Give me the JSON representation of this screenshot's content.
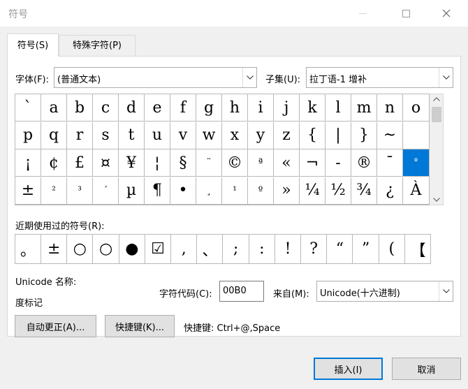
{
  "window": {
    "title": "符号"
  },
  "tabs": [
    {
      "label": "符号(S)"
    },
    {
      "label": "特殊字符(P)"
    }
  ],
  "font_label": "字体(F):",
  "font_value": "(普通文本)",
  "subset_label": "子集(U):",
  "subset_value": "拉丁语-1 增补",
  "symbols": [
    "`",
    "a",
    "b",
    "c",
    "d",
    "e",
    "f",
    "g",
    "h",
    "i",
    "j",
    "k",
    "l",
    "m",
    "n",
    "o",
    "p",
    "q",
    "r",
    "s",
    "t",
    "u",
    "v",
    "w",
    "x",
    "y",
    "z",
    "{",
    "|",
    "}",
    "~",
    "",
    "¡",
    "¢",
    "£",
    "¤",
    "¥",
    "¦",
    "§",
    "¨",
    "©",
    "ª",
    "«",
    "¬",
    "-",
    "®",
    "¯",
    "°",
    "±",
    "²",
    "³",
    "´",
    "µ",
    "¶",
    "•",
    "¸",
    "¹",
    "º",
    "»",
    "¼",
    "½",
    "¾",
    "¿",
    "À"
  ],
  "selected_index": 47,
  "recent_label": "近期使用过的符号(R):",
  "recent_symbols": [
    "。",
    "±",
    "○",
    "○",
    "●",
    "☑",
    ",",
    "、",
    ";",
    ":",
    "!",
    "?",
    "“",
    "”",
    "(",
    "【"
  ],
  "unicode_name_label": "Unicode 名称:",
  "unicode_name_value": "度标记",
  "char_code_label": "字符代码(C):",
  "char_code_value": "00B0",
  "from_label": "来自(M):",
  "from_value": "Unicode(十六进制)",
  "autocorrect_button": "自动更正(A)...",
  "shortcut_button": "快捷键(K)...",
  "shortcut_text": "快捷键: Ctrl+@,Space",
  "insert_button": "插入(I)",
  "cancel_button": "取消",
  "colors": {
    "accent": "#0078d7",
    "title_text": "#999999"
  }
}
